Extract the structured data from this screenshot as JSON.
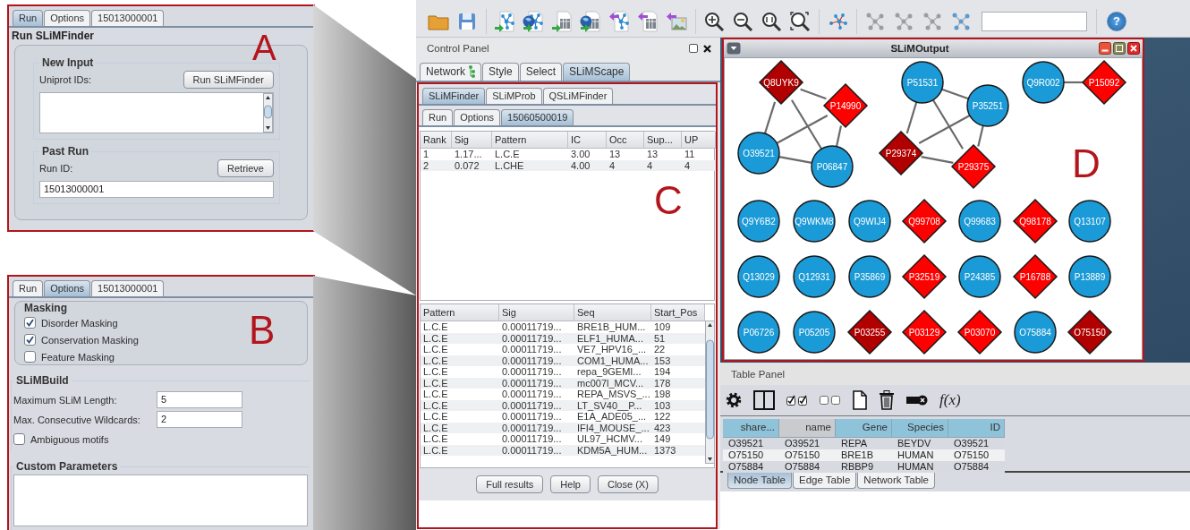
{
  "panel_a": {
    "letter": "A",
    "tabs": [
      {
        "label": "Run",
        "selected": true
      },
      {
        "label": "Options",
        "selected": false
      },
      {
        "label": "15013000001",
        "selected": false
      }
    ],
    "title": "Run SLiMFinder",
    "new_input": {
      "heading": "New Input",
      "label": "Uniprot IDs:",
      "button": "Run SLiMFinder"
    },
    "past_run": {
      "heading": "Past Run",
      "label": "Run ID:",
      "button": "Retrieve",
      "value": "15013000001"
    }
  },
  "panel_b": {
    "letter": "B",
    "tabs": [
      {
        "label": "Run",
        "selected": false
      },
      {
        "label": "Options",
        "selected": true
      },
      {
        "label": "15013000001",
        "selected": false
      }
    ],
    "masking": {
      "heading": "Masking",
      "options": [
        {
          "label": "Disorder Masking",
          "checked": true
        },
        {
          "label": "Conservation Masking",
          "checked": true
        },
        {
          "label": "Feature Masking",
          "checked": false
        }
      ]
    },
    "slimbuild": {
      "heading": "SLiMBuild",
      "fields": [
        {
          "label": "Maximum SLiM Length:",
          "value": "5"
        },
        {
          "label": "Max. Consecutive Wildcards:",
          "value": "2"
        }
      ],
      "options": [
        {
          "label": "Ambiguous motifs",
          "checked": false
        }
      ]
    },
    "custom_parameters": {
      "heading": "Custom Parameters"
    }
  },
  "toolbar": {
    "help": "?"
  },
  "control_panel": {
    "title": "Control Panel",
    "letter": "C",
    "tabs": [
      {
        "label": "Network",
        "kind": "with-icon",
        "selected": false
      },
      {
        "label": "Style",
        "kind": "plain",
        "selected": false
      },
      {
        "label": "Select",
        "kind": "plain",
        "selected": false
      },
      {
        "label": "SLiMScape",
        "kind": "plain",
        "selected": true
      }
    ],
    "app_tabs": [
      {
        "label": "SLiMFinder",
        "selected": true
      },
      {
        "label": "SLiMProb",
        "selected": false
      },
      {
        "label": "QSLiMFinder",
        "selected": false
      }
    ],
    "run_tabs": [
      {
        "label": "Run",
        "selected": false
      },
      {
        "label": "Options",
        "selected": false
      },
      {
        "label": "15060500019",
        "selected": true
      }
    ],
    "results_table": {
      "columns": [
        "Rank",
        "Sig",
        "Pattern",
        "IC",
        "Occ",
        "Sup...",
        "UP"
      ],
      "rows": [
        [
          "1",
          "1.17...",
          "L.C.E",
          "3.00",
          "13",
          "13",
          "11"
        ],
        [
          "2",
          "0.072",
          "L.CHE",
          "4.00",
          "4",
          "4",
          "4"
        ]
      ]
    },
    "hits_table": {
      "columns": [
        "Pattern",
        "Sig",
        "Seq",
        "Start_Pos"
      ],
      "rows": [
        [
          "L.C.E",
          "0.00011719...",
          "BRE1B_HUM...",
          "109"
        ],
        [
          "L.C.E",
          "0.00011719...",
          "ELF1_HUMA...",
          "51"
        ],
        [
          "L.C.E",
          "0.00011719...",
          "VE7_HPV16_...",
          "22"
        ],
        [
          "L.C.E",
          "0.00011719...",
          "COM1_HUMA...",
          "153"
        ],
        [
          "L.C.E",
          "0.00011719...",
          "repa_9GEMI...",
          "194"
        ],
        [
          "L.C.E",
          "0.00011719...",
          "mc007l_MCV...",
          "178"
        ],
        [
          "L.C.E",
          "0.00011719...",
          "REPA_MSVS_...",
          "198"
        ],
        [
          "L.C.E",
          "0.00011719...",
          "LT_SV40__P...",
          "103"
        ],
        [
          "L.C.E",
          "0.00011719...",
          "E1A_ADE05_...",
          "122"
        ],
        [
          "L.C.E",
          "0.00011719...",
          "IFI4_MOUSE_...",
          "423"
        ],
        [
          "L.C.E",
          "0.00011719...",
          "UL97_HCMV...",
          "149"
        ],
        [
          "L.C.E",
          "0.00011719...",
          "KDM5A_HUM...",
          "1373"
        ]
      ]
    },
    "buttons": [
      "Full results",
      "Help",
      "Close (X)"
    ]
  },
  "network_window": {
    "title": "SLiMOutput",
    "letter": "D",
    "nodes": [
      {
        "label": "Q8UYK9",
        "kind": "diamond",
        "color": "#b00000"
      },
      {
        "label": "P14990",
        "kind": "diamond",
        "color": "#ff0000"
      },
      {
        "label": "O39521",
        "kind": "circle",
        "color": "#1a9ad6"
      },
      {
        "label": "P06847",
        "kind": "circle",
        "color": "#1a9ad6"
      },
      {
        "label": "P51531",
        "kind": "circle",
        "color": "#1a9ad6"
      },
      {
        "label": "P35251",
        "kind": "circle",
        "color": "#1a9ad6"
      },
      {
        "label": "P29374",
        "kind": "diamond",
        "color": "#b00000"
      },
      {
        "label": "P29375",
        "kind": "diamond",
        "color": "#ff0000"
      },
      {
        "label": "Q9R002",
        "kind": "circle",
        "color": "#1a9ad6"
      },
      {
        "label": "P15092",
        "kind": "diamond",
        "color": "#ff0000"
      },
      {
        "label": "Q9Y6B2",
        "kind": "circle",
        "color": "#1a9ad6"
      },
      {
        "label": "Q9WKM8",
        "kind": "circle",
        "color": "#1a9ad6"
      },
      {
        "label": "Q9WIJ4",
        "kind": "circle",
        "color": "#1a9ad6"
      },
      {
        "label": "Q99708",
        "kind": "diamond",
        "color": "#ff0000"
      },
      {
        "label": "Q99683",
        "kind": "circle",
        "color": "#1a9ad6"
      },
      {
        "label": "Q98178",
        "kind": "diamond",
        "color": "#ff0000"
      },
      {
        "label": "Q13107",
        "kind": "circle",
        "color": "#1a9ad6"
      },
      {
        "label": "Q13029",
        "kind": "circle",
        "color": "#1a9ad6"
      },
      {
        "label": "Q12931",
        "kind": "circle",
        "color": "#1a9ad6"
      },
      {
        "label": "P35869",
        "kind": "circle",
        "color": "#1a9ad6"
      },
      {
        "label": "P32519",
        "kind": "diamond",
        "color": "#ff0000"
      },
      {
        "label": "P24385",
        "kind": "circle",
        "color": "#1a9ad6"
      },
      {
        "label": "P16788",
        "kind": "diamond",
        "color": "#ff0000"
      },
      {
        "label": "P13889",
        "kind": "circle",
        "color": "#1a9ad6"
      },
      {
        "label": "P06726",
        "kind": "circle",
        "color": "#1a9ad6"
      },
      {
        "label": "P05205",
        "kind": "circle",
        "color": "#1a9ad6"
      },
      {
        "label": "P03255",
        "kind": "diamond",
        "color": "#b00000"
      },
      {
        "label": "P03129",
        "kind": "diamond",
        "color": "#ff0000"
      },
      {
        "label": "P03070",
        "kind": "diamond",
        "color": "#ff0000"
      },
      {
        "label": "O75884",
        "kind": "circle",
        "color": "#1a9ad6"
      },
      {
        "label": "O75150",
        "kind": "diamond",
        "color": "#b00000"
      }
    ]
  },
  "table_panel": {
    "title": "Table Panel",
    "function_button": "f(x)",
    "table": {
      "columns": [
        {
          "label": "share...",
          "highlighted": true
        },
        {
          "label": "name",
          "highlighted": false
        },
        {
          "label": "Gene",
          "highlighted": true
        },
        {
          "label": "Species",
          "highlighted": true
        },
        {
          "label": "ID",
          "highlighted": true
        }
      ],
      "rows": [
        [
          "O39521",
          "O39521",
          "REPA",
          "BEYDV",
          "O39521"
        ],
        [
          "O75150",
          "O75150",
          "BRE1B",
          "HUMAN",
          "O75150"
        ],
        [
          "O75884",
          "O75884",
          "RBBP9",
          "HUMAN",
          "O75884"
        ]
      ]
    },
    "tabs": [
      {
        "label": "Node Table",
        "selected": true
      },
      {
        "label": "Edge Table",
        "selected": false
      },
      {
        "label": "Network Table",
        "selected": false
      }
    ]
  }
}
